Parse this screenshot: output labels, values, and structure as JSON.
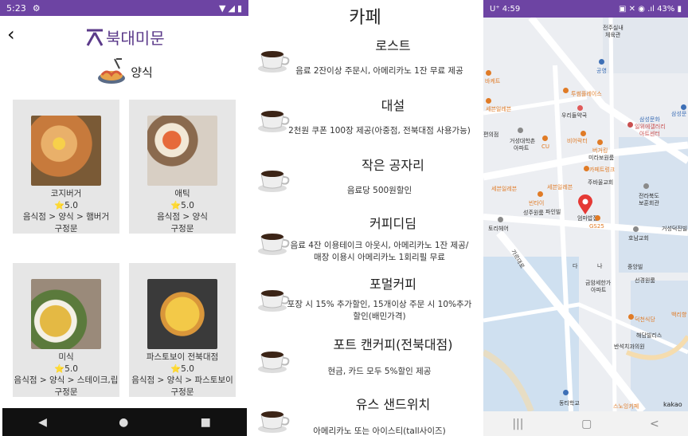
{
  "panel1": {
    "status": {
      "time": "5:23"
    },
    "brand": "북대미문",
    "category_title": "양식",
    "cards": [
      {
        "name": "코지버거",
        "rating": "⭐5.0",
        "path": "음식점 > 양식 > 햄버거",
        "area": "구정문"
      },
      {
        "name": "애틱",
        "rating": "⭐5.0",
        "path": "음식점 > 양식",
        "area": "구정문"
      },
      {
        "name": "미식",
        "rating": "⭐5.0",
        "path": "음식점 > 양식 > 스테이크,립",
        "area": "구정문"
      },
      {
        "name": "파스토보이 전북대점",
        "rating": "⭐5.0",
        "path": "음식점 > 양식 > 파스토보이",
        "area": "구정문"
      }
    ]
  },
  "panel2": {
    "title": "카페",
    "cafes": [
      {
        "name": "로스트",
        "desc_lines": [
          "음료 2잔이상 주문시, 아메리카노 1잔 무료 제공"
        ]
      },
      {
        "name": "대설",
        "desc_lines": [
          "2천원 쿠폰 100장 제공(아중점, 전북대점 사용가능)"
        ]
      },
      {
        "name": "작은 공자리",
        "desc_lines": [
          "음료당 500원할인"
        ]
      },
      {
        "name": "커피디딤",
        "desc_lines": [
          "음료 4잔 이용테이크 아웃시, 아메리카노 1잔 제공/",
          "매장 이용시 아메리카노 1회리필 무료"
        ]
      },
      {
        "name": "포멀커피",
        "desc_lines": [
          "포장 시 15% 추가할인, 15개이상 주문 시 10%추가",
          "할인(배민가격)"
        ]
      },
      {
        "name": "포트 캔커피(전북대점)",
        "desc_lines": [
          "현금, 카드 모두 5%할인 제공"
        ]
      },
      {
        "name": "유스 샌드위치",
        "desc_lines": [
          "아메리카노 또는 아이스티(tall사이즈)"
        ]
      }
    ]
  },
  "panel3": {
    "status": {
      "time": "4:59",
      "battery": "43%"
    },
    "kakao": "kakao",
    "labels": [
      {
        "t": "전주실내",
        "c": ""
      },
      {
        "t": "체육관",
        "c": ""
      },
      {
        "t": "공영",
        "c": "b"
      },
      {
        "t": "바케트",
        "c": "o"
      },
      {
        "t": "투썸플레이스",
        "c": "o"
      },
      {
        "t": "세븐일레븐",
        "c": "o"
      },
      {
        "t": "우리들약국",
        "c": ""
      },
      {
        "t": "거성대학촌",
        "c": ""
      },
      {
        "t": "아파트",
        "c": ""
      },
      {
        "t": "비어락터",
        "c": "o"
      },
      {
        "t": "CU",
        "c": "o"
      },
      {
        "t": "일위에갤러리",
        "c": "r"
      },
      {
        "t": "아트센터",
        "c": "r"
      },
      {
        "t": "버거킹",
        "c": "o"
      },
      {
        "t": "미라보원룸",
        "c": ""
      },
      {
        "t": "카페트렁크",
        "c": "o"
      },
      {
        "t": "주바울교회",
        "c": ""
      },
      {
        "t": "세븐일레븐",
        "c": "o"
      },
      {
        "t": "빈타이",
        "c": "o"
      },
      {
        "t": "전라북도",
        "c": ""
      },
      {
        "t": "보훈회관",
        "c": ""
      },
      {
        "t": "성주원룸",
        "c": ""
      },
      {
        "t": "파인빌",
        "c": ""
      },
      {
        "t": "엄마밥집",
        "c": ""
      },
      {
        "t": "GS25",
        "c": "o"
      },
      {
        "t": "토리헤어",
        "c": ""
      },
      {
        "t": "호남교회",
        "c": ""
      },
      {
        "t": "거성덕진빌",
        "c": ""
      },
      {
        "t": "중앙빌",
        "c": ""
      },
      {
        "t": "금암세한가",
        "c": ""
      },
      {
        "t": "아파트",
        "c": ""
      },
      {
        "t": "선경원룸",
        "c": ""
      },
      {
        "t": "덕천식당",
        "c": "o"
      },
      {
        "t": "백리향",
        "c": "o"
      },
      {
        "t": "해담빌리스",
        "c": ""
      },
      {
        "t": "반석치과의원",
        "c": ""
      },
      {
        "t": "동티학교",
        "c": ""
      },
      {
        "t": "스노잉키페",
        "c": "o"
      },
      {
        "t": "삼성문",
        "c": "b"
      },
      {
        "t": "가르대로",
        "c": ""
      },
      {
        "t": "다",
        "c": ""
      },
      {
        "t": "나",
        "c": ""
      },
      {
        "t": "세븐일레븐",
        "c": "o"
      },
      {
        "t": "편의점",
        "c": ""
      },
      {
        "t": "삼성문화",
        "c": "b"
      }
    ]
  }
}
